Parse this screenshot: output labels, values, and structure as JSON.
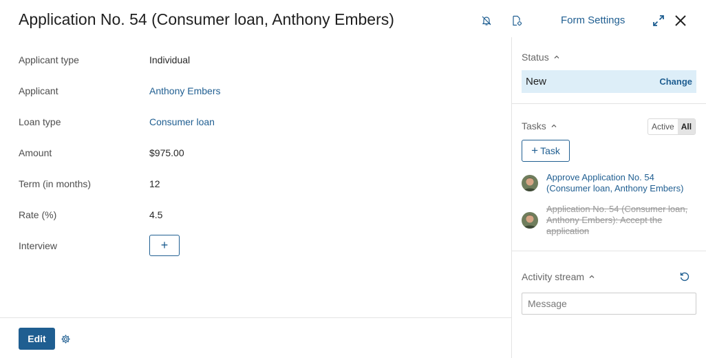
{
  "header": {
    "title": "Application No. 54 (Consumer loan, Anthony Embers)",
    "form_settings": "Form Settings",
    "icons": [
      "bell-off-icon",
      "document-settings-icon",
      "expand-icon",
      "close-icon"
    ]
  },
  "fields": [
    {
      "label": "Applicant type",
      "value": "Individual",
      "link": false
    },
    {
      "label": "Applicant",
      "value": "Anthony Embers",
      "link": true
    },
    {
      "label": "Loan type",
      "value": "Consumer loan",
      "link": true
    },
    {
      "label": "Amount",
      "value": "$975.00",
      "link": false
    },
    {
      "label": "Term (in months)",
      "value": "12",
      "link": false
    },
    {
      "label": "Rate (%)",
      "value": "4.5",
      "link": false
    },
    {
      "label": "Interview",
      "add_symbol": "+"
    }
  ],
  "footer": {
    "edit_label": "Edit"
  },
  "status": {
    "title": "Status",
    "value": "New",
    "change_label": "Change"
  },
  "tasks": {
    "title": "Tasks",
    "filter": {
      "active": "Active",
      "all": "All",
      "selected": "All"
    },
    "add_label": "Task",
    "add_symbol": "+",
    "items": [
      {
        "text": "Approve Application No. 54 (Consumer loan, Anthony Embers)",
        "completed": false
      },
      {
        "text": "Application No. 54 (Consumer loan, Anthony Embers): Accept the application",
        "completed": true
      }
    ]
  },
  "activity": {
    "title": "Activity stream",
    "placeholder": "Message"
  },
  "colors": {
    "accent": "#1f5e91",
    "status_bg": "#ddeef8",
    "divider": "#e3e3e3"
  }
}
